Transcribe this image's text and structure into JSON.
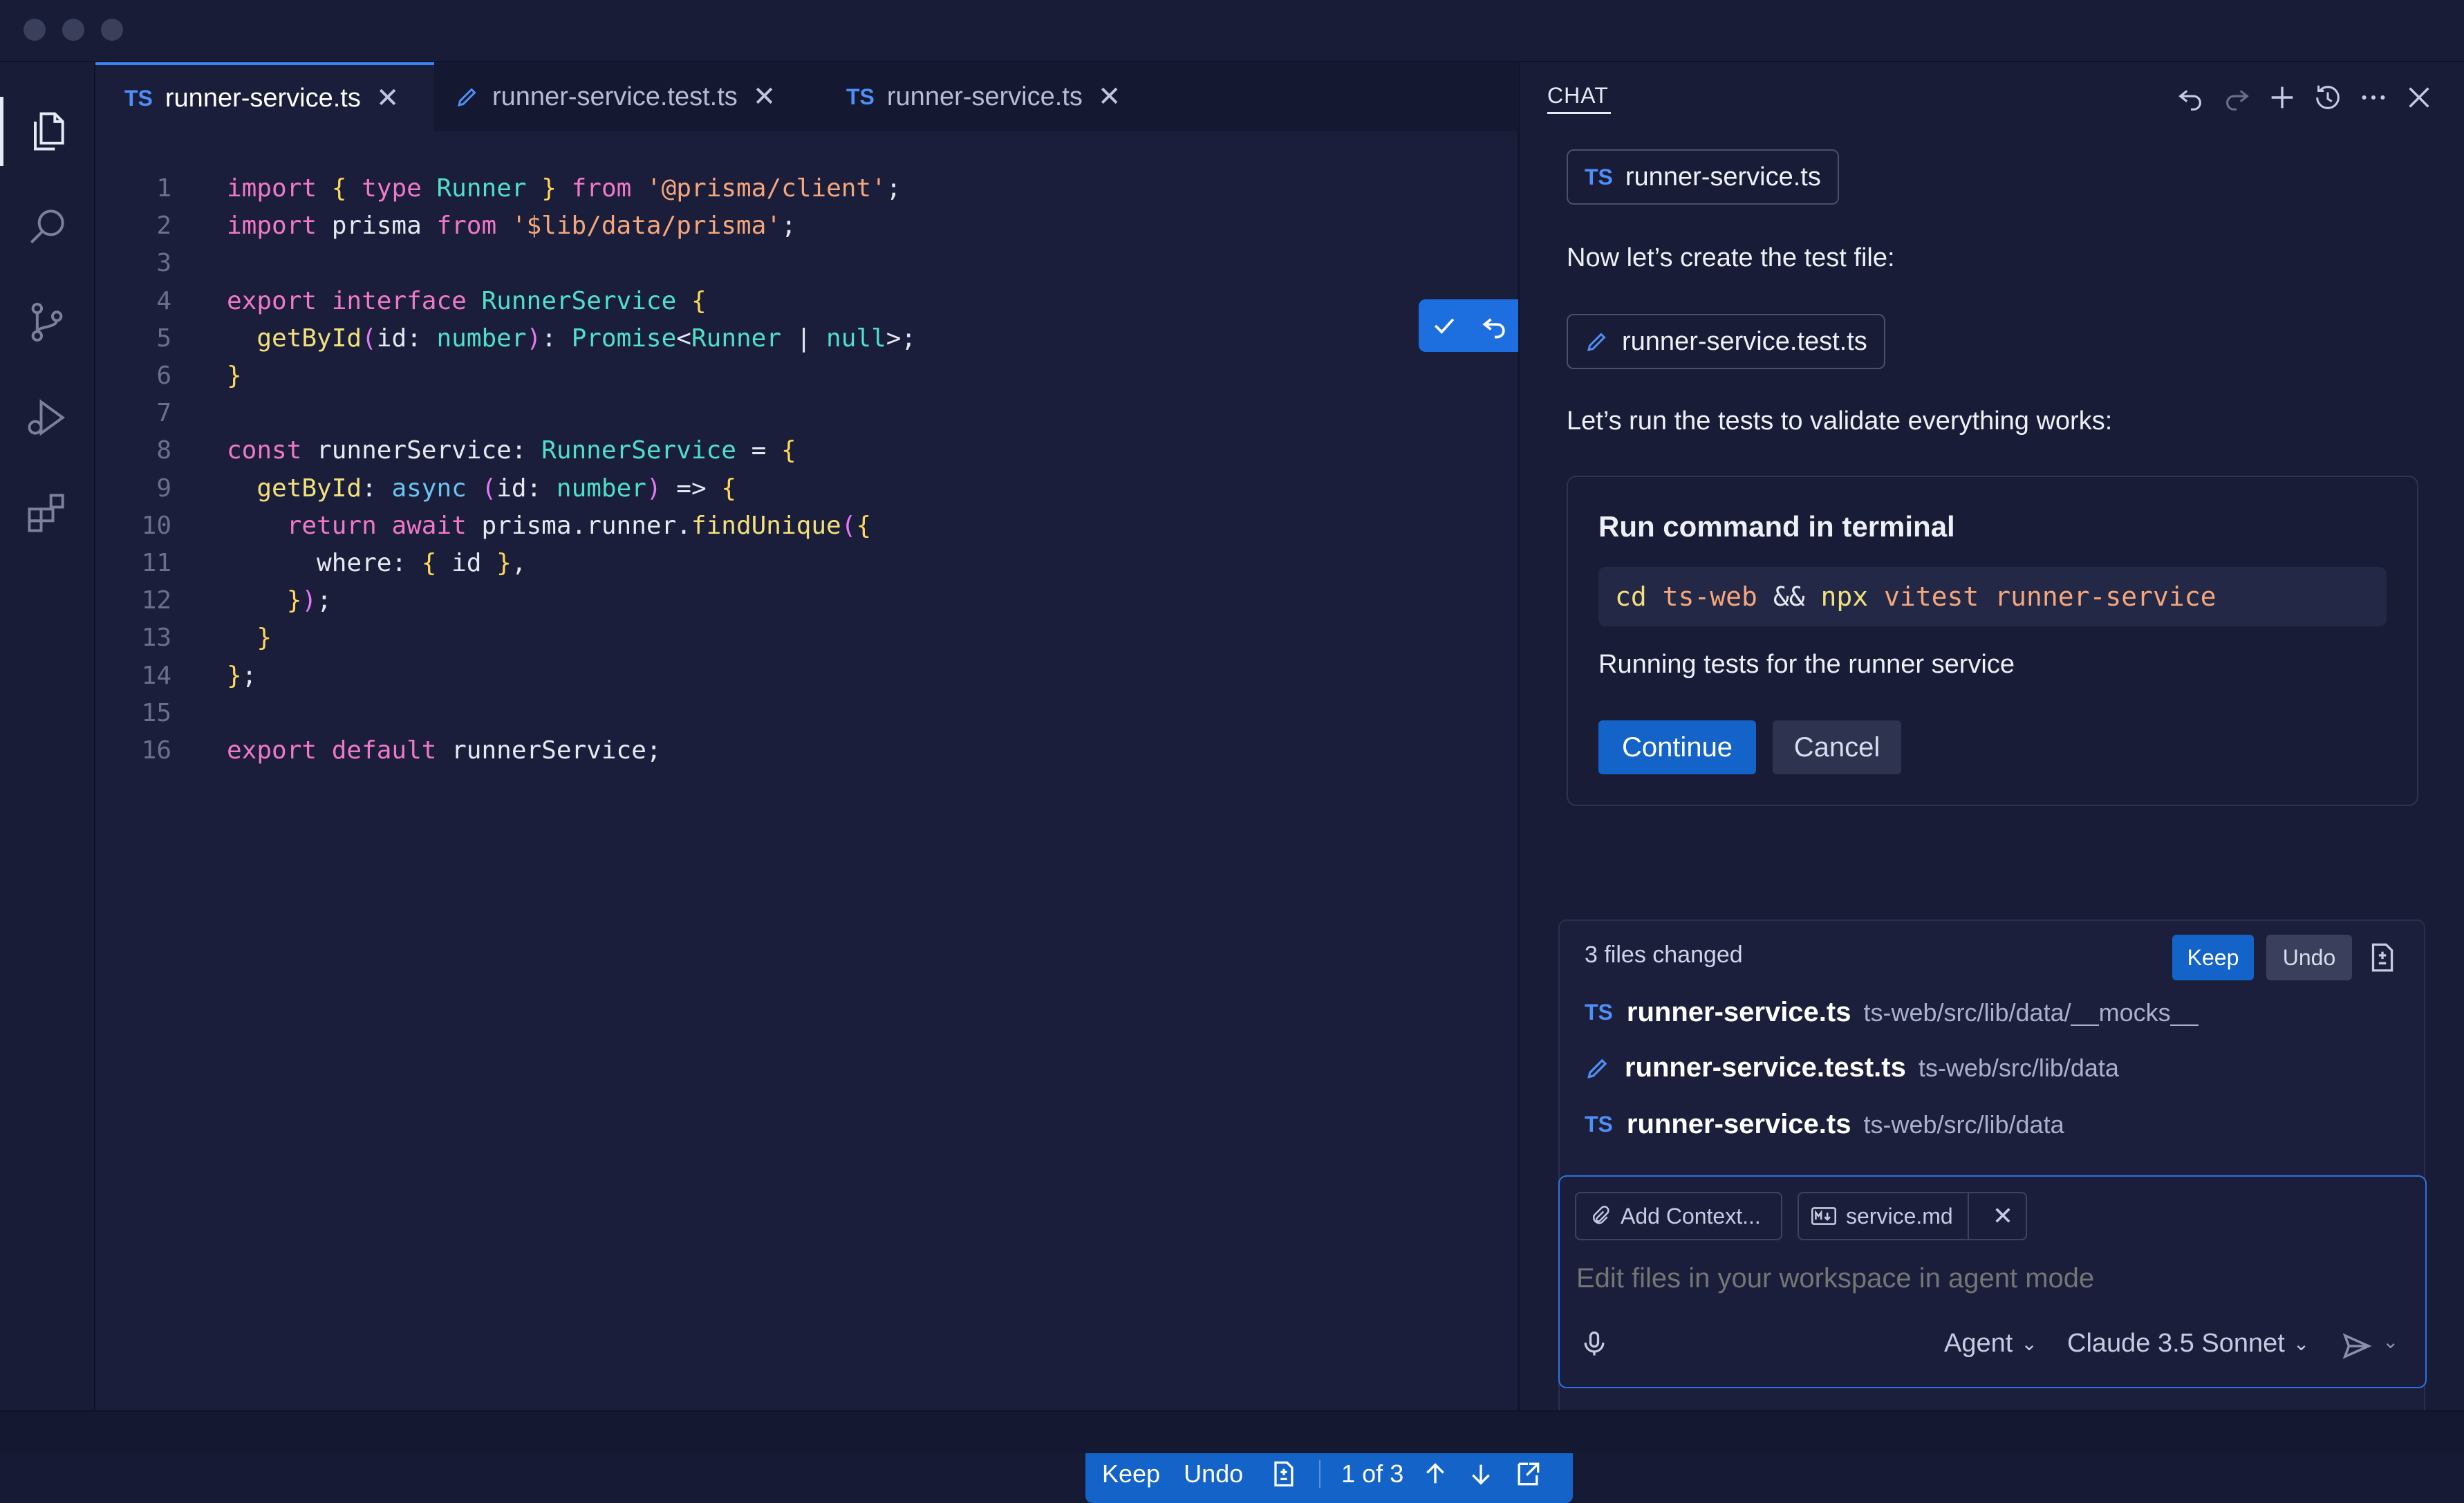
{
  "editor": {
    "tabs": [
      {
        "badge": "TS",
        "label": "runner-service.ts",
        "active": true
      },
      {
        "badge": "",
        "label": "runner-service.test.ts",
        "active": false
      },
      {
        "badge": "TS",
        "label": "runner-service.ts",
        "active": false
      }
    ],
    "line_numbers": [
      "1",
      "2",
      "3",
      "4",
      "5",
      "6",
      "7",
      "8",
      "9",
      "10",
      "11",
      "12",
      "13",
      "14",
      "15",
      "16"
    ],
    "code_lines": [
      "import { type Runner } from '@prisma/client';",
      "import prisma from '$lib/data/prisma';",
      "",
      "export interface RunnerService {",
      "  getById(id: number): Promise<Runner | null>;",
      "}",
      "",
      "const runnerService: RunnerService = {",
      "  getById: async (id: number) => {",
      "    return await prisma.runner.findUnique({",
      "      where: { id },",
      "    });",
      "  }",
      "};",
      "",
      "export default runnerService;"
    ],
    "bottom_bar": {
      "keep": "Keep",
      "undo": "Undo",
      "position": "1 of 3"
    }
  },
  "chat": {
    "title": "CHAT",
    "chip1": {
      "badge": "TS",
      "label": "runner-service.ts"
    },
    "text1": "Now let’s create the test file:",
    "chip2": {
      "label": "runner-service.test.ts"
    },
    "text2": "Let’s run the tests to validate everything works:",
    "run_card": {
      "title": "Run command in terminal",
      "command": {
        "cd": "cd",
        "dir": "ts-web",
        "and": "&&",
        "npx": "npx",
        "tool": "vitest",
        "arg": "runner-service"
      },
      "description": "Running tests for the runner service",
      "continue": "Continue",
      "cancel": "Cancel"
    },
    "changes": {
      "summary": "3 files changed",
      "keep": "Keep",
      "undo": "Undo",
      "files": [
        {
          "badge": "TS",
          "name": "runner-service.ts",
          "path": "ts-web/src/lib/data/__mocks__"
        },
        {
          "badge": "",
          "name": "runner-service.test.ts",
          "path": "ts-web/src/lib/data"
        },
        {
          "badge": "TS",
          "name": "runner-service.ts",
          "path": "ts-web/src/lib/data"
        }
      ]
    },
    "input": {
      "add_context": "Add Context...",
      "context_file": "service.md",
      "placeholder": "Edit files in your workspace in agent mode",
      "mode": "Agent",
      "model": "Claude 3.5 Sonnet"
    }
  },
  "colors": {
    "accent": "#1d6fe0",
    "background": "#1a1e3a",
    "panel": "#181c36"
  },
  "icons": [
    "files-icon",
    "search-icon",
    "source-control-icon",
    "run-debug-icon",
    "extensions-icon",
    "check-icon",
    "undo-icon",
    "diff-file-icon",
    "arrow-up-icon",
    "arrow-down-icon",
    "open-external-icon",
    "redo-icon",
    "plus-icon",
    "history-icon",
    "more-icon",
    "close-icon",
    "paperclip-icon",
    "markdown-icon",
    "microphone-icon",
    "send-icon",
    "chevron-down-icon",
    "pencil-icon"
  ]
}
